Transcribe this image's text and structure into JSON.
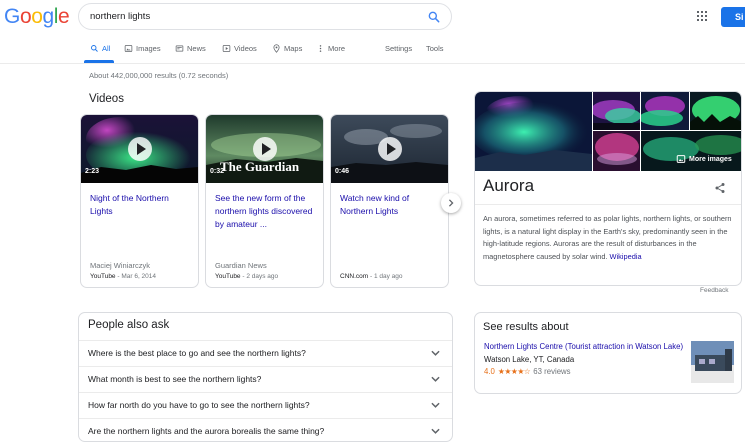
{
  "logo": {
    "text": "Google",
    "letters": [
      "G",
      "o",
      "o",
      "g",
      "l",
      "e"
    ],
    "colors": [
      "#4285f4",
      "#ea4335",
      "#fbbc05",
      "#4285f4",
      "#34a853",
      "#ea4335"
    ]
  },
  "search": {
    "query": "northern lights"
  },
  "header": {
    "signin_label": "Si"
  },
  "tabs": [
    {
      "label": "All",
      "icon": "search-icon",
      "active": true
    },
    {
      "label": "Images",
      "icon": "image-icon"
    },
    {
      "label": "News",
      "icon": "news-icon"
    },
    {
      "label": "Videos",
      "icon": "video-icon"
    },
    {
      "label": "Maps",
      "icon": "map-pin-icon"
    },
    {
      "label": "More",
      "icon": "more-vert-icon"
    },
    {
      "label": "Settings"
    },
    {
      "label": "Tools"
    }
  ],
  "result_stats": "About 442,000,000 results (0.72 seconds)",
  "videos": {
    "title": "Videos",
    "items": [
      {
        "duration": "2:23",
        "title": "Night of the Northern Lights",
        "author": "Maciej Winiarczyk",
        "source": "YouTube",
        "date": "Mar 6, 2014"
      },
      {
        "duration": "0:32",
        "title": "See the new form of the northern lights discovered by amateur ...",
        "author": "Guardian News",
        "source": "YouTube",
        "date": "2 days ago",
        "watermark": "The Guardian"
      },
      {
        "duration": "0:46",
        "title": "Watch new kind of Northern Lights",
        "author": "",
        "source": "CNN.com",
        "date": "1 day ago"
      }
    ]
  },
  "people_also_ask": {
    "title": "People also ask",
    "questions": [
      "Where is the best place to go and see the northern lights?",
      "What month is best to see the northern lights?",
      "How far north do you have to go to see the northern lights?",
      "Are the northern lights and the aurora borealis the same thing?"
    ]
  },
  "knowledge_panel": {
    "title": "Aurora",
    "more_images_label": "More images",
    "description": "An aurora, sometimes referred to as polar lights, northern lights, or southern lights, is a natural light display in the Earth's sky, predominantly seen in the high-latitude regions. Auroras are the result of disturbances in the magnetosphere caused by solar wind.",
    "source_link": "Wikipedia",
    "feedback_label": "Feedback"
  },
  "see_results_about": {
    "title": "See results about",
    "name": "Northern Lights Centre (Tourist attraction in Watson Lake)",
    "location": "Watson Lake, YT, Canada",
    "rating": "4.0",
    "stars": "★★★★☆",
    "reviews": "63 reviews"
  },
  "colors": {
    "accent": "#1a73e8",
    "link": "#1a0dab",
    "star": "#e7711b"
  }
}
